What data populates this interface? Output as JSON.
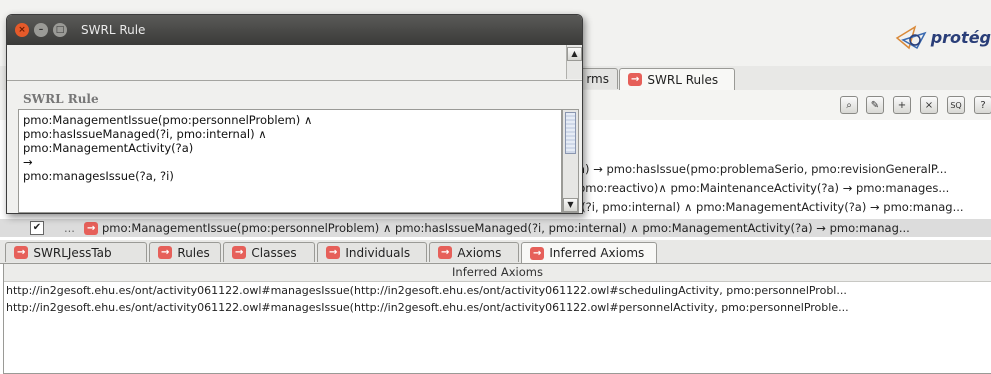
{
  "app": {
    "logo_text": "protég"
  },
  "main_tabs": {
    "partial_label": "rms",
    "swrl_rules_label": "SWRL Rules"
  },
  "toolbar": {
    "buttons": [
      {
        "icon": "zoom-icon",
        "glyph": "⌕"
      },
      {
        "icon": "new-rule-icon",
        "glyph": "✎"
      },
      {
        "icon": "add-rule-icon",
        "glyph": "+"
      },
      {
        "icon": "delete-rule-icon",
        "glyph": "×"
      },
      {
        "icon": "sqwrl-icon",
        "glyph": "SQ"
      },
      {
        "icon": "help-icon",
        "glyph": "?"
      }
    ]
  },
  "rules_list": {
    "lines": [
      "a) → pmo:hasIssue(pmo:problemaSerio, pmo:revisionGeneralP...",
      "pmo:reactivo)∧  pmo:MaintenanceActivity(?a) → pmo:manages...",
      "l(?i, pmo:internal) ∧ pmo:ManagementActivity(?a) → pmo:manag..."
    ],
    "selected_row": {
      "checked": "✔",
      "prefix": "...",
      "text": "pmo:ManagementIssue(pmo:personnelProblem) ∧ pmo:hasIssueManaged(?i, pmo:internal) ∧ pmo:ManagementActivity(?a) → pmo:manag..."
    }
  },
  "bottom_tabs": [
    {
      "label": "SWRLJessTab"
    },
    {
      "label": "Rules"
    },
    {
      "label": "Classes"
    },
    {
      "label": "Individuals"
    },
    {
      "label": "Axioms"
    },
    {
      "label": "Inferred Axioms"
    }
  ],
  "inferred_panel": {
    "header": "Inferred Axioms",
    "rows": [
      "http://in2gesoft.ehu.es/ont/activity061122.owl#managesIssue(http://in2gesoft.ehu.es/ont/activity061122.owl#schedulingActivity, pmo:personnelProbl...",
      "http://in2gesoft.ehu.es/ont/activity061122.owl#managesIssue(http://in2gesoft.ehu.es/ont/activity061122.owl#personnelActivity, pmo:personnelProble..."
    ]
  },
  "dialog": {
    "title": "SWRL Rule",
    "section_label": "SWRL Rule",
    "rule_text": "pmo:ManagementIssue(pmo:personnelProblem) ∧\npmo:hasIssueManaged(?i, pmo:internal) ∧\npmo:ManagementActivity(?a)\n→\npmo:managesIssue(?a, ?i)",
    "close_glyph": "×",
    "min_glyph": "–",
    "max_glyph": "□",
    "scroll_up_glyph": "▲",
    "scroll_down_glyph": "▼"
  },
  "colors": {
    "tab_arrow": "#e6605a",
    "titlebar": "#3a3a38",
    "close_button": "#e55a2a",
    "logo": "#2a3e78"
  }
}
